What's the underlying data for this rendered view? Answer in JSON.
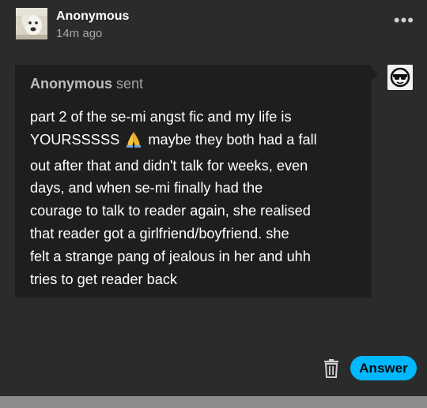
{
  "post": {
    "author": "Anonymous",
    "time": "14m ago",
    "more_icon": "ellipsis-icon"
  },
  "ask": {
    "sender": "Anonymous",
    "verb": "sent",
    "lines": [
      "part 2 of the se-mi angst fic and my life is",
      "YOURSSSSS",
      "maybe they both had a fall",
      "out after that and didn't talk for weeks, even",
      "days, and when se-mi finally had the",
      "courage to talk to reader again, she realised",
      "that reader got a girlfriend/boyfriend. she",
      "felt a strange pang of jealous in her and uhh",
      "tries to get reader back"
    ],
    "emoji": "folded-hands-emoji"
  },
  "actions": {
    "delete_icon": "trash-icon",
    "answer_label": "Answer",
    "answer_color": "#00b8ff"
  }
}
